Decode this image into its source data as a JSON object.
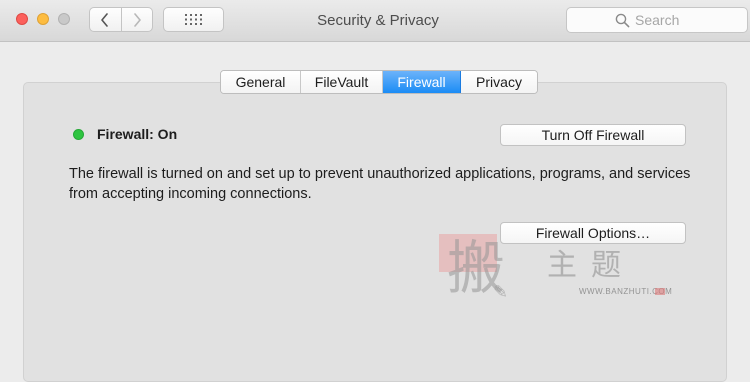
{
  "window": {
    "title": "Security & Privacy"
  },
  "search": {
    "placeholder": "Search",
    "value": ""
  },
  "tabs": [
    {
      "label": "General",
      "active": false
    },
    {
      "label": "FileVault",
      "active": false
    },
    {
      "label": "Firewall",
      "active": true
    },
    {
      "label": "Privacy",
      "active": false
    }
  ],
  "firewall": {
    "status_label": "Firewall: On",
    "status_color": "#2ec440",
    "turn_off_label": "Turn Off Firewall",
    "description": "The firewall is turned on and set up to prevent unauthorized applications, programs, and services from accepting incoming connections.",
    "options_label": "Firewall Options…"
  },
  "watermark": {
    "seal_char": "搬",
    "text": "主题",
    "domain": "WWW.BANZHUTI.COM"
  },
  "colors": {
    "accent": "#1b8cf5",
    "close": "#fc605c",
    "minimize": "#fdbc40",
    "zoom_inactive": "#c9c9c9"
  },
  "icons": {
    "back": "chevron-left-icon",
    "forward": "chevron-right-icon",
    "show_all": "grid-icon",
    "search": "magnifier-icon"
  }
}
